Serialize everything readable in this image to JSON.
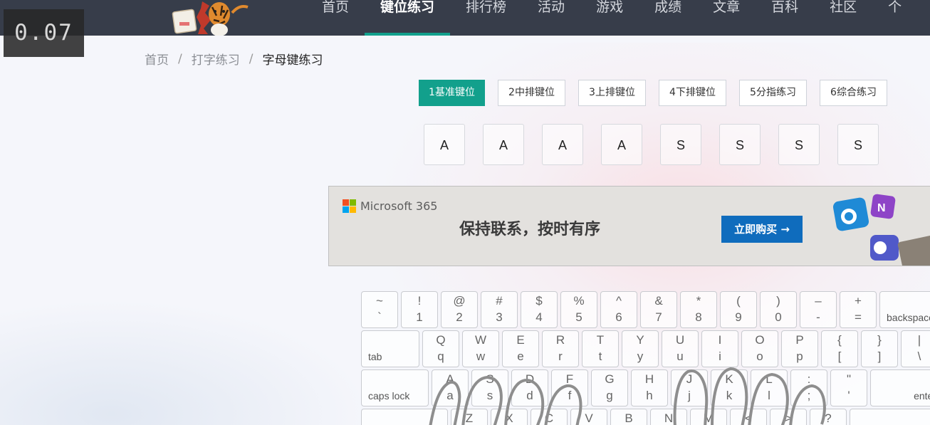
{
  "timer": "0.07",
  "nav": {
    "items": [
      {
        "label": "首页",
        "active": false
      },
      {
        "label": "键位练习",
        "active": true
      },
      {
        "label": "排行榜",
        "active": false
      },
      {
        "label": "活动",
        "active": false
      },
      {
        "label": "游戏",
        "active": false
      },
      {
        "label": "成绩",
        "active": false
      },
      {
        "label": "文章",
        "active": false
      },
      {
        "label": "百科",
        "active": false
      },
      {
        "label": "社区",
        "active": false
      },
      {
        "label": "个",
        "active": false
      }
    ]
  },
  "breadcrumb": {
    "items": [
      "首页",
      "打字练习"
    ],
    "separator": "/",
    "current": "字母键练习"
  },
  "tabs": [
    {
      "label": "1基准键位",
      "active": true
    },
    {
      "label": "2中排键位",
      "active": false
    },
    {
      "label": "3上排键位",
      "active": false
    },
    {
      "label": "4下排键位",
      "active": false
    },
    {
      "label": "5分指练习",
      "active": false
    },
    {
      "label": "6综合练习",
      "active": false
    }
  ],
  "sequence": [
    "A",
    "A",
    "A",
    "A",
    "S",
    "S",
    "S",
    "S"
  ],
  "ad": {
    "brand": "Microsoft 365",
    "slogan": "保持联系，按时有序",
    "button": "立即购买 →",
    "brand_colors": [
      "#f25022",
      "#7fba00",
      "#00a4ef",
      "#ffb900"
    ]
  },
  "keyboard": {
    "row1": [
      {
        "up": "~",
        "low": "`"
      },
      {
        "up": "!",
        "low": "1"
      },
      {
        "up": "@",
        "low": "2"
      },
      {
        "up": "#",
        "low": "3"
      },
      {
        "up": "$",
        "low": "4"
      },
      {
        "up": "%",
        "low": "5"
      },
      {
        "up": "^",
        "low": "6"
      },
      {
        "up": "&",
        "low": "7"
      },
      {
        "up": "*",
        "low": "8"
      },
      {
        "up": "(",
        "low": "9"
      },
      {
        "up": ")",
        "low": "0"
      },
      {
        "up": "–",
        "low": "-"
      },
      {
        "up": "+",
        "low": "="
      }
    ],
    "backspace": "backspace",
    "tab": "tab",
    "row2": [
      {
        "up": "Q",
        "low": "q"
      },
      {
        "up": "W",
        "low": "w"
      },
      {
        "up": "E",
        "low": "e"
      },
      {
        "up": "R",
        "low": "r"
      },
      {
        "up": "T",
        "low": "t"
      },
      {
        "up": "Y",
        "low": "y"
      },
      {
        "up": "U",
        "low": "u"
      },
      {
        "up": "I",
        "low": "i"
      },
      {
        "up": "O",
        "low": "o"
      },
      {
        "up": "P",
        "low": "p"
      },
      {
        "up": "{",
        "low": "["
      },
      {
        "up": "}",
        "low": "]"
      },
      {
        "up": "|",
        "low": "\\"
      }
    ],
    "capslock": "caps lock",
    "row3": [
      {
        "up": "A",
        "low": "a"
      },
      {
        "up": "S",
        "low": "s"
      },
      {
        "up": "D",
        "low": "d"
      },
      {
        "up": "F",
        "low": "f"
      },
      {
        "up": "G",
        "low": "g"
      },
      {
        "up": "H",
        "low": "h"
      },
      {
        "up": "J",
        "low": "j"
      },
      {
        "up": "K",
        "low": "k"
      },
      {
        "up": "L",
        "low": "l"
      },
      {
        "up": ":",
        "low": ";"
      },
      {
        "up": "\"",
        "low": "'"
      }
    ],
    "enter": "enter",
    "row4": [
      {
        "up": "Z"
      },
      {
        "up": "X"
      },
      {
        "up": "C"
      },
      {
        "up": "V"
      },
      {
        "up": "B"
      },
      {
        "up": "N"
      },
      {
        "up": "M"
      },
      {
        "up": "<"
      },
      {
        "up": ">"
      },
      {
        "up": "?"
      }
    ]
  }
}
